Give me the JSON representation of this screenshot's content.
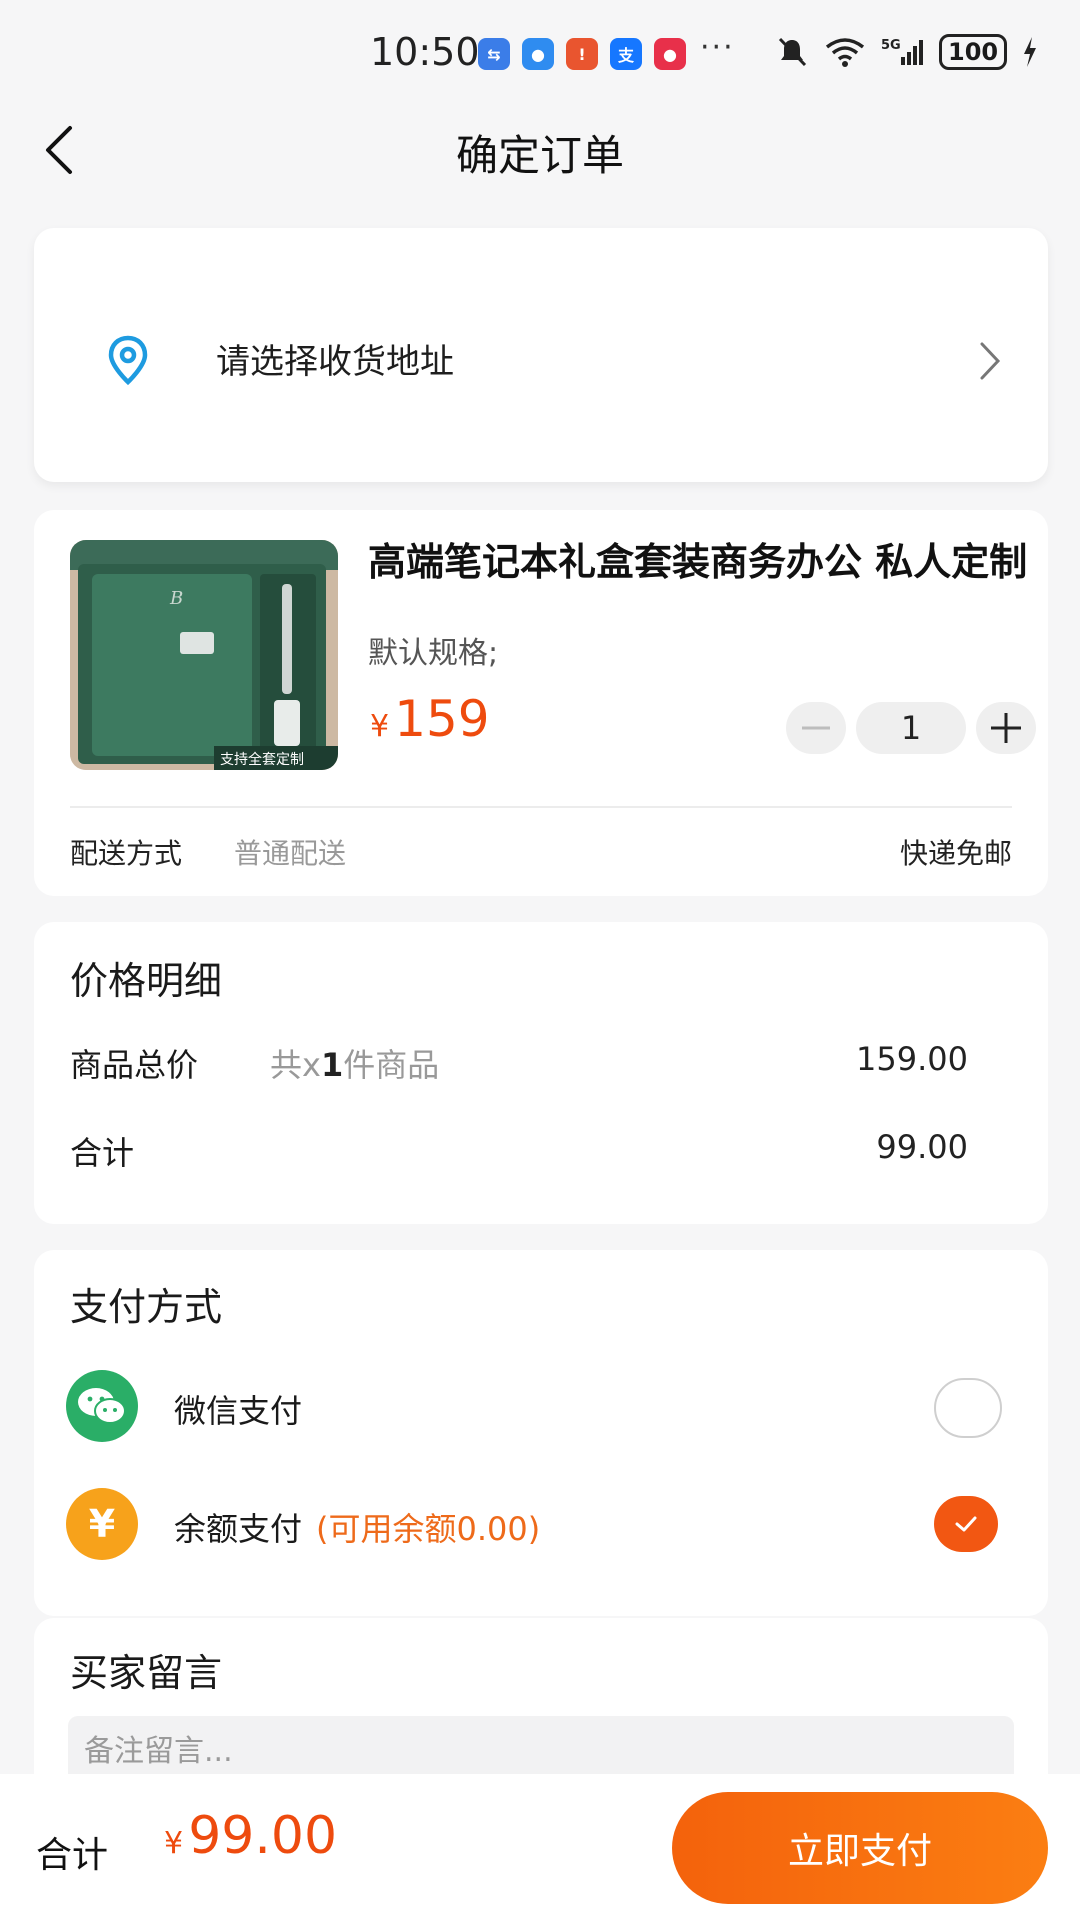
{
  "status_bar": {
    "time": "10:50",
    "app_icons": [
      {
        "name": "usb-icon",
        "glyph": "⇆",
        "color": "#3b7de8"
      },
      {
        "name": "message-icon",
        "glyph": "●",
        "color": "#2f8cf0"
      },
      {
        "name": "notification-app-icon",
        "glyph": "!",
        "color": "#e9552f"
      },
      {
        "name": "alipay-icon",
        "glyph": "支",
        "color": "#1677ff"
      },
      {
        "name": "shopping-app-icon",
        "glyph": "●",
        "color": "#e8304a"
      }
    ],
    "more": "···",
    "battery": "100"
  },
  "nav": {
    "title": "确定订单"
  },
  "address": {
    "placeholder_text": "请选择收货地址"
  },
  "product": {
    "name": "高端笔记本礼盒套装商务办公 私人定制",
    "spec": "默认规格;",
    "currency": "¥",
    "price": "159",
    "quantity": "1",
    "image_badge": "支持全套定制",
    "delivery_label": "配送方式",
    "delivery_value": "普通配送",
    "delivery_note": "快递免邮"
  },
  "price_detail": {
    "title": "价格明细",
    "subtotal_label": "商品总价",
    "count_prefix": "共x",
    "count": "1",
    "count_suffix": "件商品",
    "subtotal_value": "159.00",
    "total_label": "合计",
    "total_value": "99.00"
  },
  "payment": {
    "title": "支付方式",
    "options": [
      {
        "label": "微信支付",
        "icon": "wechat-pay-icon",
        "selected": false,
        "color": "#2aae67"
      },
      {
        "label": "余额支付",
        "balance_note": "(可用余额0.00)",
        "icon": "yen-icon",
        "selected": true,
        "color": "#f7a21b"
      }
    ]
  },
  "message": {
    "title": "买家留言",
    "placeholder": "备注留言..."
  },
  "bottom": {
    "total_label": "合计",
    "currency": "¥",
    "total": "99.00",
    "pay_button": "立即支付"
  },
  "colors": {
    "accent": "#ee4b0e",
    "button": "#f4620c",
    "pin": "#1e9be0"
  }
}
